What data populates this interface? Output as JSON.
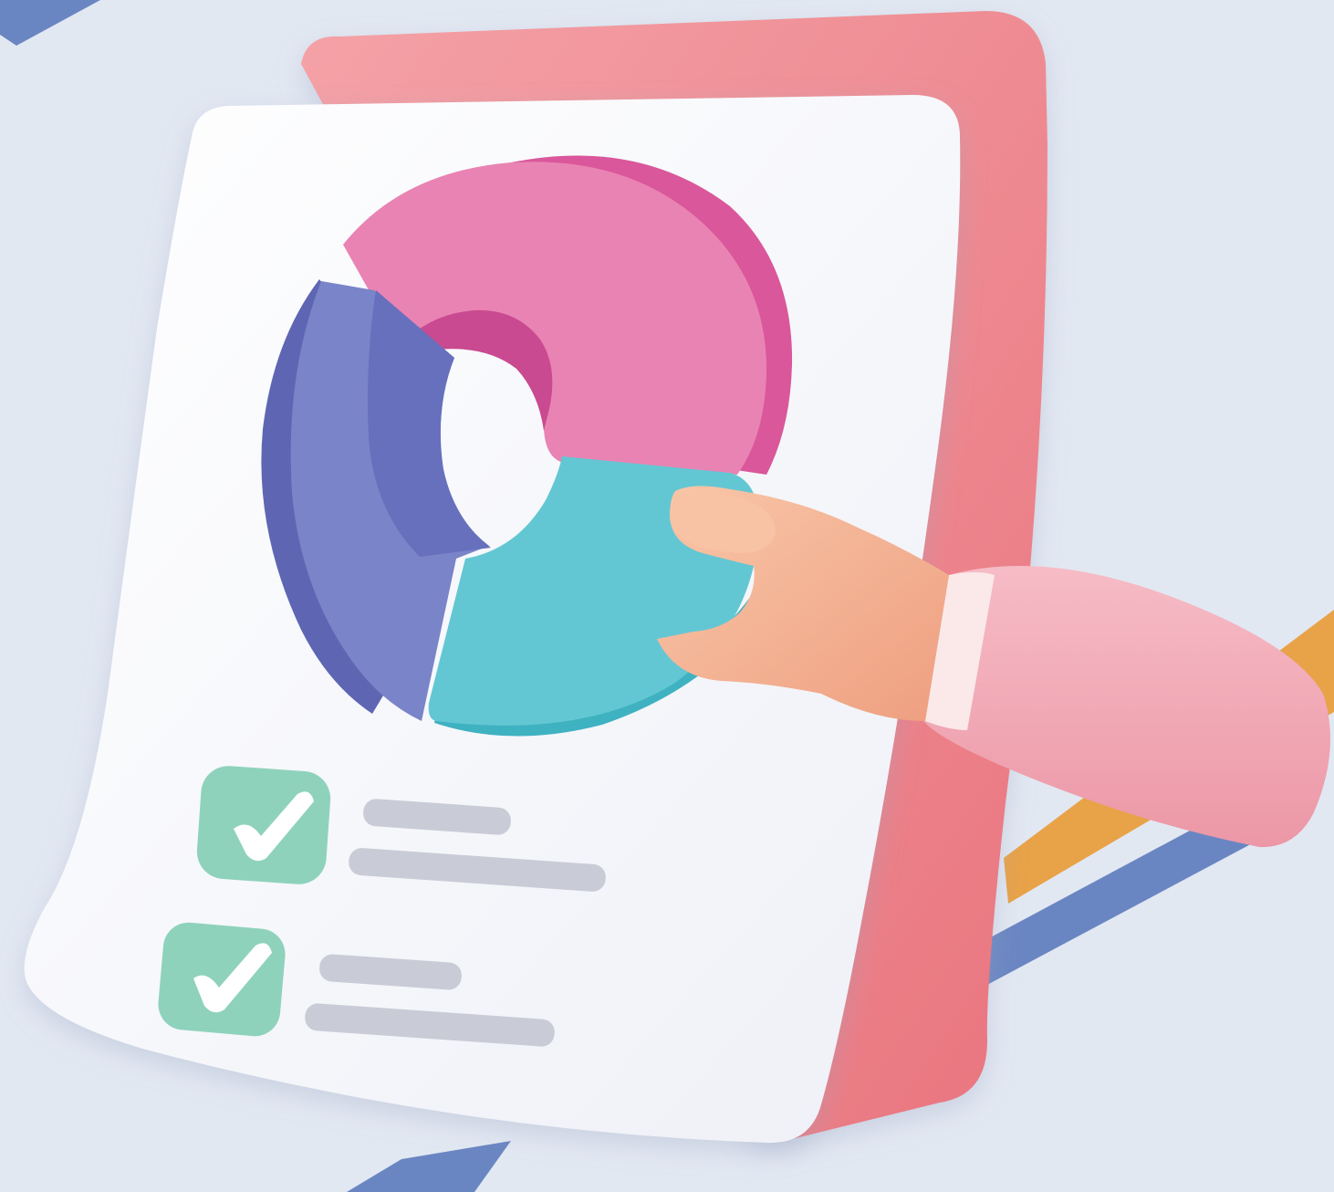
{
  "illustration": {
    "subject": "report-document-with-donut-chart",
    "colors": {
      "background": "#e2e8f2",
      "stripe_blue": "#6a86c2",
      "stripe_orange": "#e8a248",
      "back_card": "#ee848d",
      "paper": "#f3f5fb",
      "donut_pink": "#e983b3",
      "donut_blue": "#7a84c8",
      "donut_teal": "#63c7d3",
      "check_tile": "#8fd2bc",
      "line_placeholder": "#c9ccd6",
      "skin": "#f4b494",
      "sleeve": "#f2a9b6"
    },
    "icons": [
      "checkbox-checked-icon",
      "checkbox-checked-icon"
    ]
  }
}
